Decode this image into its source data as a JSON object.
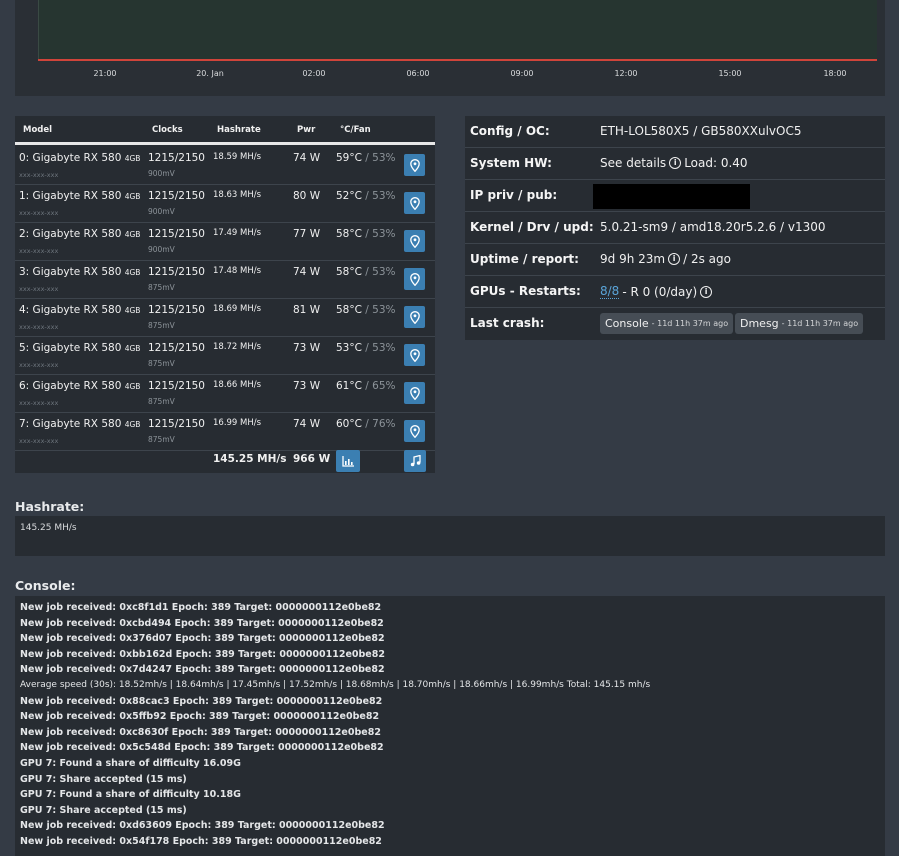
{
  "chart": {
    "x_ticks": [
      "21:00",
      "20. Jan",
      "02:00",
      "06:00",
      "09:00",
      "12:00",
      "15:00",
      "18:00"
    ],
    "colors": {
      "plot_bg": "#263530",
      "series": "#d0443a"
    }
  },
  "gpu_table": {
    "headers": {
      "model": "Model",
      "clocks": "Clocks",
      "hashrate": "Hashrate",
      "pwr": "Pwr",
      "temp_fan": "°C/Fan"
    },
    "rows": [
      {
        "model": "0: Gigabyte RX 580",
        "mem": "4GB",
        "serial": "xxx-xxx-xxx",
        "clocks": "1215/2150",
        "volt": "900mV",
        "hashrate": "18.59 MH/s",
        "pwr": "74 W",
        "temp": "59°C",
        "fan": " / 53%"
      },
      {
        "model": "1: Gigabyte RX 580",
        "mem": "4GB",
        "serial": "xxx-xxx-xxx",
        "clocks": "1215/2150",
        "volt": "900mV",
        "hashrate": "18.63 MH/s",
        "pwr": "80 W",
        "temp": "52°C",
        "fan": " / 53%"
      },
      {
        "model": "2: Gigabyte RX 580",
        "mem": "4GB",
        "serial": "xxx-xxx-xxx",
        "clocks": "1215/2150",
        "volt": "900mV",
        "hashrate": "17.49 MH/s",
        "pwr": "77 W",
        "temp": "58°C",
        "fan": " / 53%"
      },
      {
        "model": "3: Gigabyte RX 580",
        "mem": "4GB",
        "serial": "xxx-xxx-xxx",
        "clocks": "1215/2150",
        "volt": "875mV",
        "hashrate": "17.48 MH/s",
        "pwr": "74 W",
        "temp": "58°C",
        "fan": " / 53%"
      },
      {
        "model": "4: Gigabyte RX 580",
        "mem": "4GB",
        "serial": "xxx-xxx-xxx",
        "clocks": "1215/2150",
        "volt": "875mV",
        "hashrate": "18.69 MH/s",
        "pwr": "81 W",
        "temp": "58°C",
        "fan": " / 53%"
      },
      {
        "model": "5: Gigabyte RX 580",
        "mem": "4GB",
        "serial": "xxx-xxx-xxx",
        "clocks": "1215/2150",
        "volt": "875mV",
        "hashrate": "18.72 MH/s",
        "pwr": "73 W",
        "temp": "53°C",
        "fan": " / 53%"
      },
      {
        "model": "6: Gigabyte RX 580",
        "mem": "4GB",
        "serial": "xxx-xxx-xxx",
        "clocks": "1215/2150",
        "volt": "875mV",
        "hashrate": "18.66 MH/s",
        "pwr": "73 W",
        "temp": "61°C",
        "fan": " / 65%"
      },
      {
        "model": "7: Gigabyte RX 580",
        "mem": "4GB",
        "serial": "xxx-xxx-xxx",
        "clocks": "1215/2150",
        "volt": "875mV",
        "hashrate": "16.99 MH/s",
        "pwr": "74 W",
        "temp": "60°C",
        "fan": " / 76%"
      }
    ],
    "total_hashrate": "145.25 MH/s",
    "total_pwr": "966 W",
    "icons": {
      "row_button": "map-pin-icon",
      "chart_button": "bar-chart-icon",
      "sound_button": "music-note-icon"
    }
  },
  "info": {
    "config": {
      "label": "Config / OC:",
      "value": "ETH-LOL580X5 / GB580XXulvOC5"
    },
    "system_hw": {
      "label": "System HW:",
      "link": "See details",
      "load": "Load: 0.40"
    },
    "ip": {
      "label": "IP priv / pub:"
    },
    "kernel": {
      "label": "Kernel / Drv / upd:",
      "value": "5.0.21-sm9 / amd18.20r5.2.6 / v1300"
    },
    "uptime": {
      "label": "Uptime / report:",
      "value": "9d 9h 23m",
      "suffix": "/ 2s ago"
    },
    "gpus": {
      "label": "GPUs - Restarts:",
      "link": "8/8",
      "value": "- R 0 (0/day)"
    },
    "crash": {
      "label": "Last crash:",
      "console_label": "Console",
      "console_ago": "- 11d 11h 37m ago",
      "dmesg_label": "Dmesg",
      "dmesg_ago": "- 11d 11h 37m ago"
    }
  },
  "hashrate_section": {
    "title": "Hashrate:",
    "value": "145.25 MH/s"
  },
  "console": {
    "title": "Console:",
    "lines": [
      {
        "text": "New job received: 0xc8f1d1 Epoch: 389 Target: 0000000112e0be82",
        "bold": true
      },
      {
        "text": "New job received: 0xcbd494 Epoch: 389 Target: 0000000112e0be82",
        "bold": true
      },
      {
        "text": "New job received: 0x376d07 Epoch: 389 Target: 0000000112e0be82",
        "bold": true
      },
      {
        "text": "New job received: 0xbb162d Epoch: 389 Target: 0000000112e0be82",
        "bold": true
      },
      {
        "text": "New job received: 0x7d4247 Epoch: 389 Target: 0000000112e0be82",
        "bold": true
      },
      {
        "text": "Average speed (30s): 18.52mh/s | 18.64mh/s | 17.45mh/s | 17.52mh/s | 18.68mh/s | 18.70mh/s | 18.66mh/s | 16.99mh/s Total: 145.15 mh/s",
        "bold": false
      },
      {
        "text": "New job received: 0x88cac3 Epoch: 389 Target: 0000000112e0be82",
        "bold": true
      },
      {
        "text": "New job received: 0x5ffb92 Epoch: 389 Target: 0000000112e0be82",
        "bold": true
      },
      {
        "text": "New job received: 0xc8630f Epoch: 389 Target: 0000000112e0be82",
        "bold": true
      },
      {
        "text": "New job received: 0x5c548d Epoch: 389 Target: 0000000112e0be82",
        "bold": true
      },
      {
        "text": "GPU 7: Found a share of difficulty 16.09G",
        "bold": true
      },
      {
        "text": "GPU 7: Share accepted (15 ms)",
        "bold": true
      },
      {
        "text": "GPU 7: Found a share of difficulty 10.18G",
        "bold": true
      },
      {
        "text": "GPU 7: Share accepted (15 ms)",
        "bold": true
      },
      {
        "text": "New job received: 0xd63609 Epoch: 389 Target: 0000000112e0be82",
        "bold": true
      },
      {
        "text": "New job received: 0x54f178 Epoch: 389 Target: 0000000112e0be82",
        "bold": true
      }
    ]
  }
}
